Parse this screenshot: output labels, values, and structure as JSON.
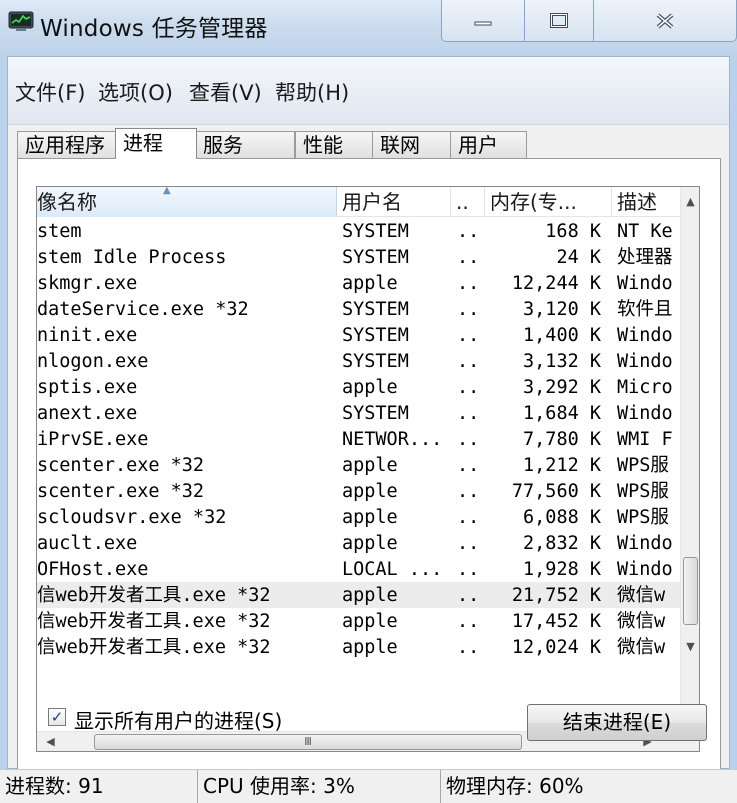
{
  "window": {
    "title": "Windows 任务管理器",
    "buttons": {
      "minimize": "—",
      "maximize": "▢",
      "close": "✕"
    }
  },
  "menu": [
    "文件(F)",
    "选项(O)",
    "查看(V)",
    "帮助(H)"
  ],
  "tabs": [
    "应用程序",
    "进程",
    "服务",
    "性能",
    "联网",
    "用户"
  ],
  "active_tab": "进程",
  "columns": {
    "name": "像名称",
    "user": "用户名",
    "cpu": "..",
    "memory": "内存(专...",
    "description": "描述"
  },
  "processes": [
    {
      "name": "stem",
      "user": "SYSTEM",
      "cpu": "..",
      "memory": "168 K",
      "description": "NT Ke"
    },
    {
      "name": "stem Idle Process",
      "user": "SYSTEM",
      "cpu": "..",
      "memory": "24 K",
      "description": "处理器"
    },
    {
      "name": "skmgr.exe",
      "user": "apple",
      "cpu": "..",
      "memory": "12,244 K",
      "description": "Windo"
    },
    {
      "name": "dateService.exe *32",
      "user": "SYSTEM",
      "cpu": "..",
      "memory": "3,120 K",
      "description": "软件且"
    },
    {
      "name": "ninit.exe",
      "user": "SYSTEM",
      "cpu": "..",
      "memory": "1,400 K",
      "description": "Windo"
    },
    {
      "name": "nlogon.exe",
      "user": "SYSTEM",
      "cpu": "..",
      "memory": "3,132 K",
      "description": "Windo"
    },
    {
      "name": "sptis.exe",
      "user": "apple",
      "cpu": "..",
      "memory": "3,292 K",
      "description": "Micro"
    },
    {
      "name": "anext.exe",
      "user": "SYSTEM",
      "cpu": "..",
      "memory": "1,684 K",
      "description": "Windo"
    },
    {
      "name": "iPrvSE.exe",
      "user": "NETWOR...",
      "cpu": "..",
      "memory": "7,780 K",
      "description": "WMI F"
    },
    {
      "name": "scenter.exe *32",
      "user": "apple",
      "cpu": "..",
      "memory": "1,212 K",
      "description": "WPS服"
    },
    {
      "name": "scenter.exe *32",
      "user": "apple",
      "cpu": "..",
      "memory": "77,560 K",
      "description": "WPS服"
    },
    {
      "name": "scloudsvr.exe *32",
      "user": "apple",
      "cpu": "..",
      "memory": "6,088 K",
      "description": "WPS服"
    },
    {
      "name": "auclt.exe",
      "user": "apple",
      "cpu": "..",
      "memory": "2,832 K",
      "description": "Windo"
    },
    {
      "name": "OFHost.exe",
      "user": "LOCAL ...",
      "cpu": "..",
      "memory": "1,928 K",
      "description": "Windo"
    },
    {
      "name": "信web开发者工具.exe *32",
      "user": "apple",
      "cpu": "..",
      "memory": "21,752 K",
      "description": "微信w"
    },
    {
      "name": "信web开发者工具.exe *32",
      "user": "apple",
      "cpu": "..",
      "memory": "17,452 K",
      "description": "微信w"
    },
    {
      "name": "信web开发者工具.exe *32",
      "user": "apple",
      "cpu": "..",
      "memory": "12,024 K",
      "description": "微信w"
    }
  ],
  "selected_row_index": 14,
  "show_all_users": {
    "label": "显示所有用户的进程(S)",
    "checked": true,
    "mark": "✓"
  },
  "end_process_button": "结束进程(E)",
  "scrollbar": {
    "grip": "Ⅲ",
    "up": "▲",
    "down": "▼",
    "left": "◀",
    "right": "▶"
  },
  "status": {
    "processes": "进程数: 91",
    "cpu": "CPU 使用率: 3%",
    "memory": "物理内存: 60%"
  }
}
